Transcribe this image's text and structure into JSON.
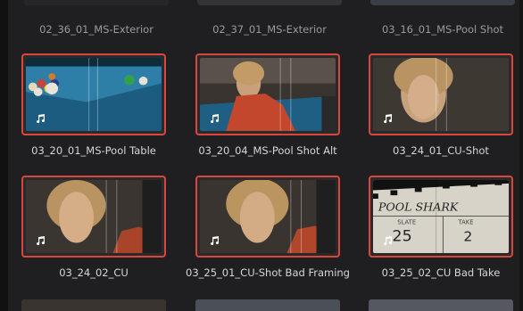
{
  "media_pool": {
    "clips_top_partial": [
      {
        "name": "02_36_01_MS-Exterior"
      },
      {
        "name": "02_37_01_MS-Exterior"
      },
      {
        "name": "03_16_01_MS-Pool Shot"
      }
    ],
    "clips": [
      {
        "name": "03_20_01_MS-Pool Table",
        "selected": true,
        "has_audio": true
      },
      {
        "name": "03_20_04_MS-Pool Shot Alt",
        "selected": true,
        "has_audio": true
      },
      {
        "name": "03_24_01_CU-Shot",
        "selected": true,
        "has_audio": true
      },
      {
        "name": "03_24_02_CU",
        "selected": true,
        "has_audio": true
      },
      {
        "name": "03_25_01_CU-Shot Bad Framing",
        "selected": true,
        "has_audio": true
      },
      {
        "name": "03_25_02_CU Bad Take",
        "selected": true,
        "has_audio": true
      }
    ],
    "slate": {
      "title": "POOL SHARK",
      "slate_label": "SLATE",
      "slate_value": "25",
      "take_label": "TAKE",
      "take_value": "2"
    },
    "colors": {
      "selection_border": "#d9473c",
      "background": "#1f1f21",
      "label_text": "#d6d6d6"
    },
    "icons": {
      "audio": "music-note-icon"
    }
  }
}
